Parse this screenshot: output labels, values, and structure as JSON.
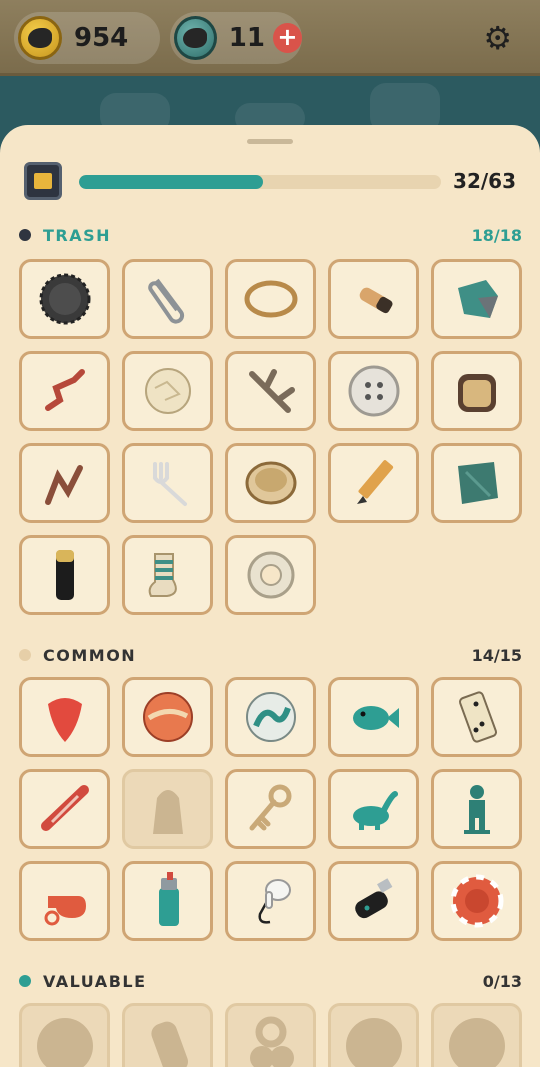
{
  "topbar": {
    "coins": "954",
    "tokens": "11",
    "plus_label": "+"
  },
  "collection": {
    "progress_text": "32/63",
    "progress_fraction": 0.5079
  },
  "sections": [
    {
      "title": "TRASH",
      "count": "18/18",
      "dot_color": "#2f3540",
      "title_color": "#2e9e93",
      "items": [
        {
          "icon": "bottle-cap-icon",
          "found": true
        },
        {
          "icon": "paperclip-icon",
          "found": true
        },
        {
          "icon": "rubber-band-icon",
          "found": true
        },
        {
          "icon": "cigarette-butt-icon",
          "found": true
        },
        {
          "icon": "crumpled-wrapper-icon",
          "found": true
        },
        {
          "icon": "bent-straw-icon",
          "found": true
        },
        {
          "icon": "paper-ball-icon",
          "found": true
        },
        {
          "icon": "twig-icon",
          "found": true
        },
        {
          "icon": "button-icon",
          "found": true
        },
        {
          "icon": "toast-slice-icon",
          "found": true
        },
        {
          "icon": "bent-nail-icon",
          "found": true
        },
        {
          "icon": "plastic-fork-icon",
          "found": true
        },
        {
          "icon": "wooden-bowl-icon",
          "found": true
        },
        {
          "icon": "pencil-icon",
          "found": true
        },
        {
          "icon": "wet-rag-icon",
          "found": true
        },
        {
          "icon": "battery-icon",
          "found": true
        },
        {
          "icon": "striped-sock-icon",
          "found": true
        },
        {
          "icon": "tape-roll-icon",
          "found": true
        }
      ]
    },
    {
      "title": "COMMON",
      "count": "14/15",
      "dot_color": "#e6cfa8",
      "title_color": "#333333",
      "items": [
        {
          "icon": "guitar-pick-icon",
          "found": true
        },
        {
          "icon": "orange-marble-icon",
          "found": true
        },
        {
          "icon": "teal-marble-icon",
          "found": true
        },
        {
          "icon": "toy-fish-icon",
          "found": true
        },
        {
          "icon": "domino-icon",
          "found": true
        },
        {
          "icon": "hair-clip-icon",
          "found": true
        },
        {
          "icon": "thimble-silhouette-icon",
          "found": false
        },
        {
          "icon": "old-key-icon",
          "found": true
        },
        {
          "icon": "toy-dinosaur-icon",
          "found": true
        },
        {
          "icon": "toy-soldier-icon",
          "found": true
        },
        {
          "icon": "whistle-icon",
          "found": true
        },
        {
          "icon": "lighter-icon",
          "found": true
        },
        {
          "icon": "earbud-icon",
          "found": true
        },
        {
          "icon": "usb-stick-icon",
          "found": true
        },
        {
          "icon": "poker-chip-icon",
          "found": true
        }
      ]
    },
    {
      "title": "VALUABLE",
      "count": "0/13",
      "dot_color": "#2e9e93",
      "title_color": "#333333",
      "items": [
        {
          "icon": "round-silhouette-icon",
          "found": false
        },
        {
          "icon": "tag-silhouette-icon",
          "found": false
        },
        {
          "icon": "keys-silhouette-icon",
          "found": false
        },
        {
          "icon": "round-silhouette-icon",
          "found": false
        },
        {
          "icon": "round-silhouette-icon",
          "found": false
        }
      ]
    }
  ]
}
